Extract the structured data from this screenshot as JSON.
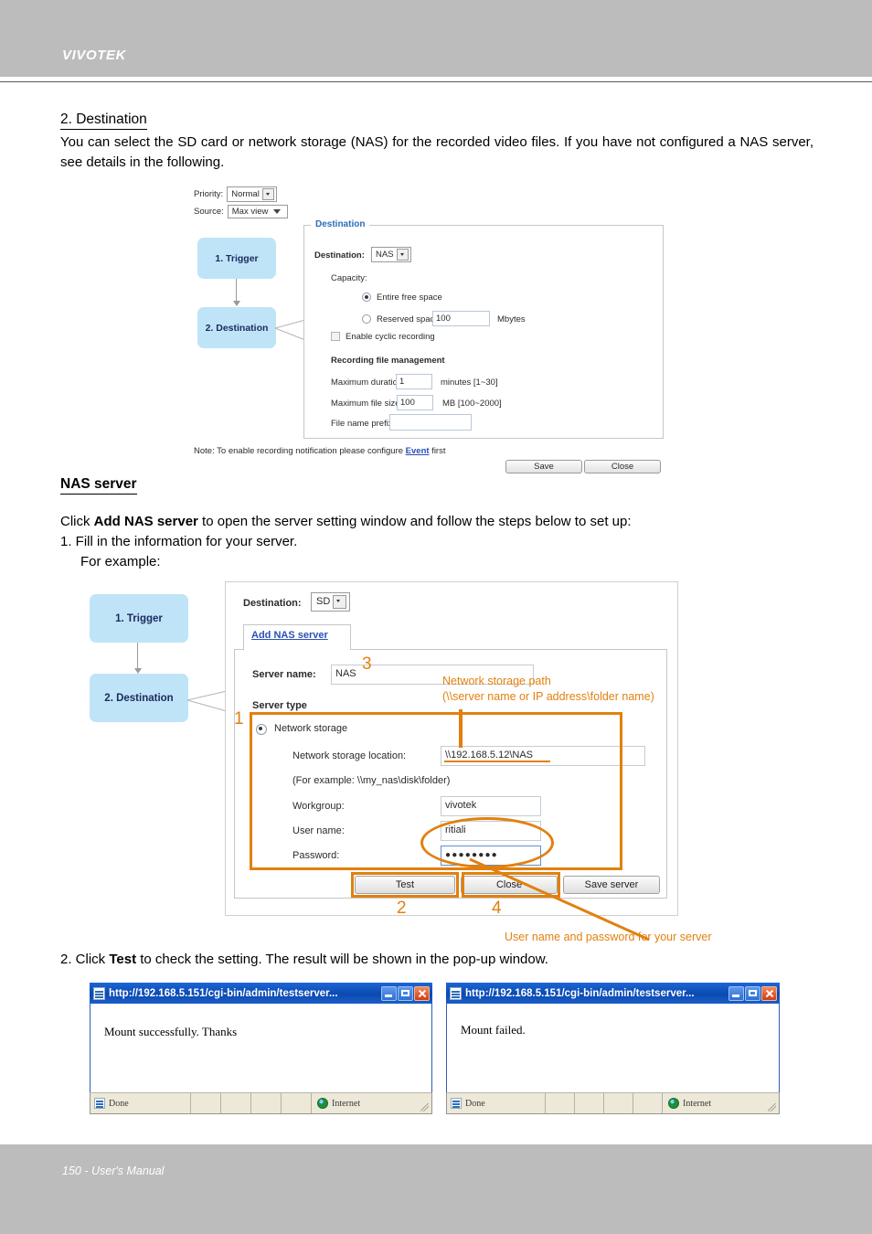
{
  "page": {
    "brand": "VIVOTEK",
    "footer": "150 - User's Manual"
  },
  "sections": {
    "destination_heading": "2. Destination",
    "destination_para": "You can select the SD card or network storage (NAS) for the recorded video files. If you have not configured a NAS server, see details in the following.",
    "nas_heading": "NAS server",
    "nas_para_prefix": "Click ",
    "nas_para_bold": "Add NAS server",
    "nas_para_suffix": " to open the server setting window and follow the steps below to set up:",
    "nas_step1": "1. Fill in the information for your server.",
    "nas_step1_example": "For example:",
    "step2_prefix": "2. Click ",
    "step2_bold": "Test",
    "step2_suffix": " to check the setting. The result will be shown in the pop-up window."
  },
  "figure1": {
    "priority_label": "Priority:",
    "priority_value": "Normal",
    "source_label": "Source:",
    "source_value": "Max view",
    "flow": [
      {
        "label": "1. Trigger"
      },
      {
        "label": "2. Destination"
      }
    ],
    "group_legend": "Destination",
    "destination_label": "Destination:",
    "destination_value": "NAS",
    "capacity_label": "Capacity:",
    "entire_free_space": "Entire free space",
    "reserved_space_label": "Reserved space:",
    "reserved_space_value": "100",
    "reserved_space_unit": "Mbytes",
    "enable_cyclic": "Enable cyclic recording",
    "recording_file_management": "Recording file management",
    "max_duration_label": "Maximum duration:",
    "max_duration_value": "1",
    "max_duration_unit": "minutes [1~30]",
    "max_file_size_label": "Maximum file size:",
    "max_file_size_value": "100",
    "max_file_size_unit": "MB [100~2000]",
    "file_name_prefix_label": "File name prefix:",
    "file_name_prefix_value": "",
    "note_prefix": "Note: To enable recording notification please configure ",
    "note_link": "Event",
    "note_suffix": " first",
    "save_button": "Save",
    "close_button": "Close"
  },
  "figure2": {
    "flow": [
      {
        "label": "1. Trigger"
      },
      {
        "label": "2. Destination"
      }
    ],
    "destination_label": "Destination:",
    "destination_value": "SD",
    "tab_label": "Add NAS server",
    "server_name_label": "Server name:",
    "server_name_value": "NAS",
    "server_type_label": "Server type",
    "network_storage_radio": "Network storage",
    "network_location_label": "Network storage location:",
    "network_location_value": "\\\\192.168.5.12\\NAS",
    "for_example": "(For example: \\\\my_nas\\disk\\folder)",
    "workgroup_label": "Workgroup:",
    "workgroup_value": "vivotek",
    "username_label": "User name:",
    "username_value": "ritiali",
    "password_label": "Password:",
    "password_value": "●●●●●●●●",
    "test_button": "Test",
    "close_button": "Close",
    "save_server_button": "Save server",
    "annotations": {
      "num1": "1",
      "num2": "2",
      "num3": "3",
      "num4": "4",
      "path_note_line1": "Network storage path",
      "path_note_line2": "(\\\\server name or IP address\\folder name)",
      "credentials_note": "User name and password for your server",
      "accent_color": "#e2800f"
    }
  },
  "popups": [
    {
      "title": "http://192.168.5.151/cgi-bin/admin/testserver...",
      "message": "Mount successfully. Thanks",
      "status_left": "Done",
      "status_right": "Internet"
    },
    {
      "title": "http://192.168.5.151/cgi-bin/admin/testserver...",
      "message": "Mount failed.",
      "status_left": "Done",
      "status_right": "Internet"
    }
  ]
}
